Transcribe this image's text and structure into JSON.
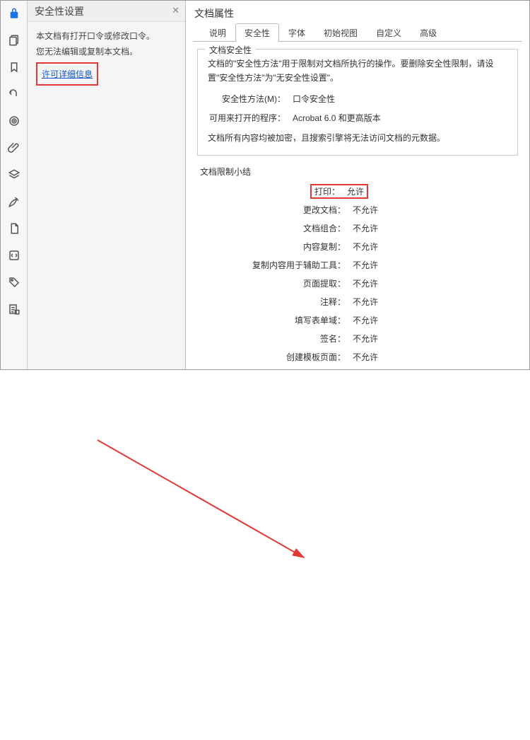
{
  "iconbar": {
    "items": [
      {
        "name": "lock-icon"
      },
      {
        "name": "pages-icon"
      },
      {
        "name": "bookmark-icon"
      },
      {
        "name": "undo-redo-icon"
      },
      {
        "name": "target-icon"
      },
      {
        "name": "attachment-icon"
      },
      {
        "name": "layers-icon"
      },
      {
        "name": "pen-icon"
      },
      {
        "name": "page-icon"
      },
      {
        "name": "swap-icon"
      },
      {
        "name": "tag-icon"
      },
      {
        "name": "checklist-icon"
      }
    ]
  },
  "leftpanel": {
    "title": "安全性设置",
    "line1": "本文档有打开口令或修改口令。",
    "line2": "您无法编辑或复制本文档。",
    "link": "许可详细信息"
  },
  "rightpanel": {
    "title": "文档属性",
    "tabs": [
      "说明",
      "安全性",
      "字体",
      "初始视图",
      "自定义",
      "高级"
    ],
    "active_tab": 1,
    "security_group": {
      "title": "文档安全性",
      "desc": "文档的\"安全性方法\"用于限制对文档所执行的操作。要删除安全性限制，请设置\"安全性方法\"为\"无安全性设置\"。",
      "method_label": "安全性方法(M)：",
      "method_value": "口令安全性",
      "openwith_label": "可用来打开的程序：",
      "openwith_value": "Acrobat 6.0 和更高版本",
      "encrypt_note": "文档所有内容均被加密，且搜索引擎将无法访问文档的元数据。"
    },
    "restrictions": {
      "title": "文档限制小结",
      "rows": [
        {
          "label": "打印：",
          "value": "允许",
          "hl": true
        },
        {
          "label": "更改文档：",
          "value": "不允许"
        },
        {
          "label": "文档组合：",
          "value": "不允许"
        },
        {
          "label": "内容复制：",
          "value": "不允许"
        },
        {
          "label": "复制内容用于辅助工具：",
          "value": "不允许"
        },
        {
          "label": "页面提取：",
          "value": "不允许"
        },
        {
          "label": "注释：",
          "value": "不允许"
        },
        {
          "label": "填写表单域：",
          "value": "不允许"
        },
        {
          "label": "签名：",
          "value": "不允许"
        },
        {
          "label": "创建模板页面：",
          "value": "不允许"
        }
      ]
    }
  }
}
